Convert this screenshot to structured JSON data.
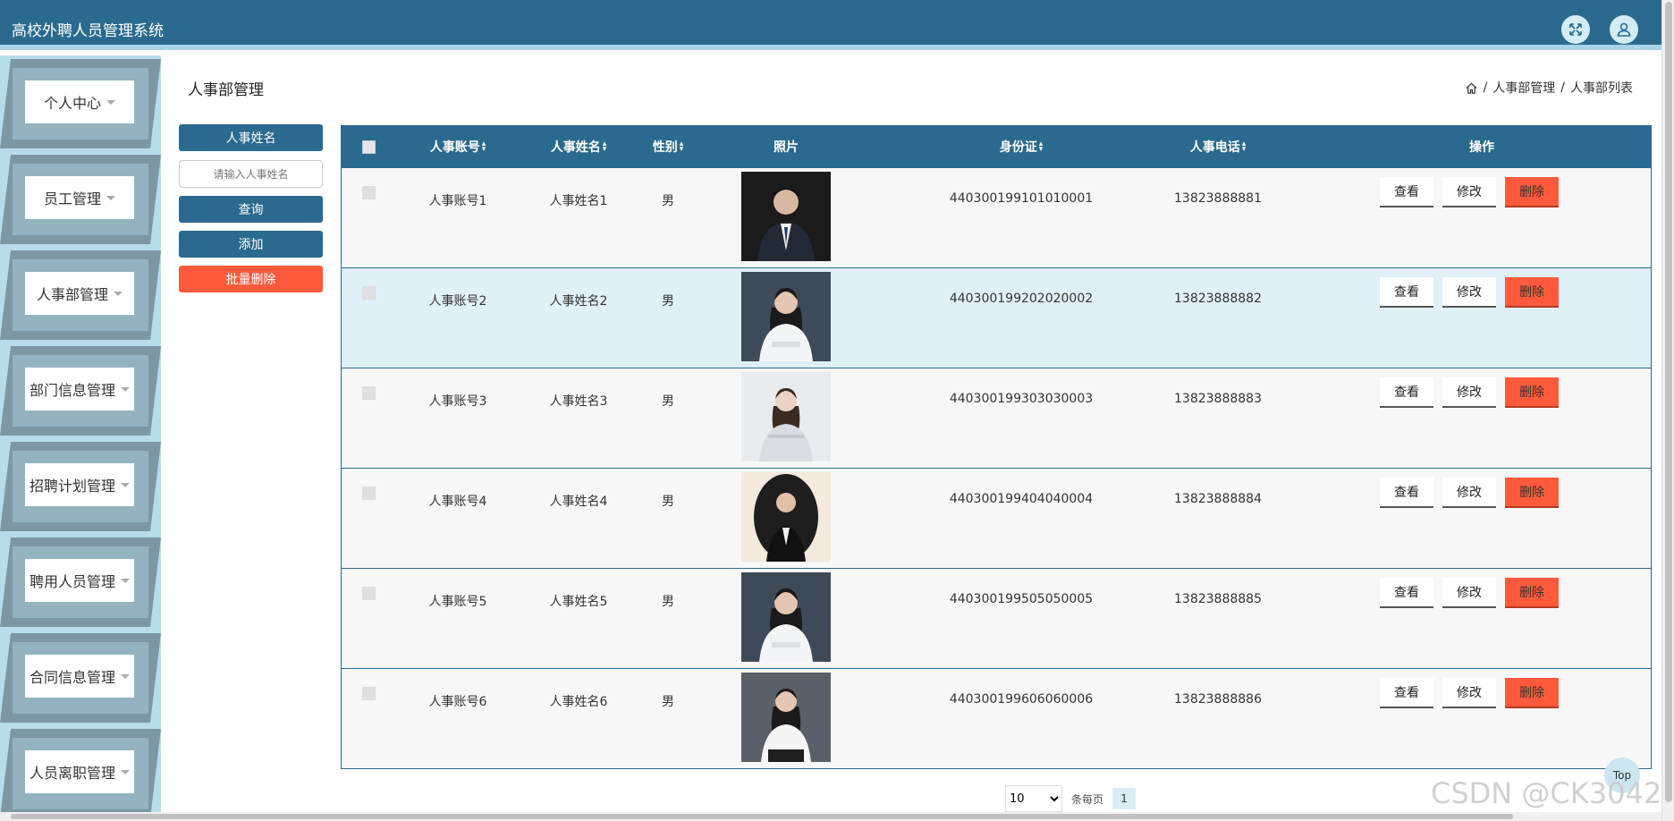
{
  "app": {
    "title": "高校外聘人员管理系统"
  },
  "header": {
    "fullscreen_icon": "fullscreen-icon",
    "user_icon": "user-icon"
  },
  "sidebar": {
    "items": [
      {
        "label": "个人中心"
      },
      {
        "label": "员工管理"
      },
      {
        "label": "人事部管理"
      },
      {
        "label": "部门信息管理"
      },
      {
        "label": "招聘计划管理"
      },
      {
        "label": "聘用人员管理"
      },
      {
        "label": "合同信息管理"
      },
      {
        "label": "人员离职管理"
      }
    ]
  },
  "page": {
    "title": "人事部管理",
    "breadcrumb": [
      "人事部管理",
      "人事部列表"
    ],
    "breadcrumb_sep": "/"
  },
  "search": {
    "field_label": "人事姓名",
    "placeholder": "请输入人事姓名",
    "query_label": "查询",
    "add_label": "添加",
    "batch_delete_label": "批量删除"
  },
  "table": {
    "columns": [
      "人事账号",
      "人事姓名",
      "性别",
      "照片",
      "身份证",
      "人事电话",
      "操作"
    ],
    "rows": [
      {
        "account": "人事账号1",
        "name": "人事姓名1",
        "gender": "男",
        "id_card": "440300199101010001",
        "phone": "13823888881",
        "photo": "man-suit"
      },
      {
        "account": "人事账号2",
        "name": "人事姓名2",
        "gender": "男",
        "id_card": "440300199202020002",
        "phone": "13823888882",
        "photo": "woman-white"
      },
      {
        "account": "人事账号3",
        "name": "人事姓名3",
        "gender": "男",
        "id_card": "440300199303030003",
        "phone": "13823888883",
        "photo": "woman-light"
      },
      {
        "account": "人事账号4",
        "name": "人事姓名4",
        "gender": "男",
        "id_card": "440300199404040004",
        "phone": "13823888884",
        "photo": "woman-oval"
      },
      {
        "account": "人事账号5",
        "name": "人事姓名5",
        "gender": "男",
        "id_card": "440300199505050005",
        "phone": "13823888885",
        "photo": "woman-white"
      },
      {
        "account": "人事账号6",
        "name": "人事姓名6",
        "gender": "男",
        "id_card": "440300199606060006",
        "phone": "13823888886",
        "photo": "woman-gray"
      }
    ],
    "actions": {
      "view": "查看",
      "edit": "修改",
      "delete": "删除"
    }
  },
  "pagination": {
    "page_size": "10",
    "per_page_label": "条每页",
    "current_page": "1"
  },
  "back_to_top": "Top",
  "watermark": "CSDN @CK3042",
  "colors": {
    "primary": "#2a6a8e",
    "danger": "#ff5a3c",
    "sidebar_bg": "#b7dde9",
    "row_alt": "#dff0f7"
  }
}
